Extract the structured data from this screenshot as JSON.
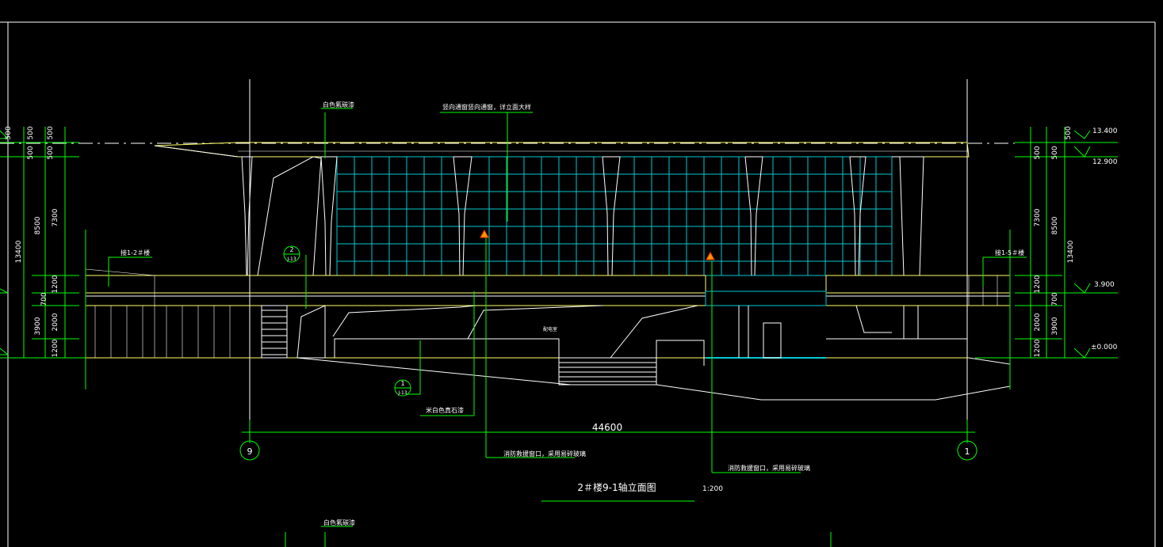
{
  "drawing": {
    "title": "2＃楼9-1轴立面图",
    "scale": "1:200",
    "overall_dimension": "44600",
    "axis_labels": {
      "left": "9",
      "right": "1"
    },
    "left_dims_inner": [
      "500",
      "500",
      "7300",
      "1200",
      "700",
      "2000",
      "1200"
    ],
    "left_dims_mid": [
      "8500",
      "3900"
    ],
    "left_dims_outer": [
      "500",
      "13400"
    ],
    "right_dims_inner": [
      "500",
      "500",
      "7300",
      "1200",
      "700",
      "2000",
      "1200"
    ],
    "right_dims_mid": [
      "8500",
      "3900"
    ],
    "right_dims_outer": [
      "500",
      "13400"
    ],
    "elevations": [
      "13.400",
      "12.900",
      "3.900",
      "±0.000"
    ],
    "notes": {
      "top_left": "白色氟碳漆",
      "top_center": "竖向通窗竖向通窗，详立面大样",
      "stair_left": "接1-2＃楼",
      "stair_right": "接1-5＃楼",
      "bottom_left": "米白色真石漆",
      "fire_window_1": "消防救援窗口，采用易碎玻璃",
      "fire_window_2": "消防救援窗口，采用易碎玻璃",
      "bottom_partial": "白色氟碳漆",
      "room_label": "配电室"
    },
    "detail_tags": [
      {
        "num": "2",
        "ref": "J-13"
      },
      {
        "num": "1",
        "ref": "J-13"
      }
    ]
  },
  "colors": {
    "background": "#000000",
    "line_green": "#00ff00",
    "line_white": "#ffffff",
    "line_yellow": "#ffff66",
    "glass_cyan": "#00c8d0",
    "text": "#ffffff"
  }
}
